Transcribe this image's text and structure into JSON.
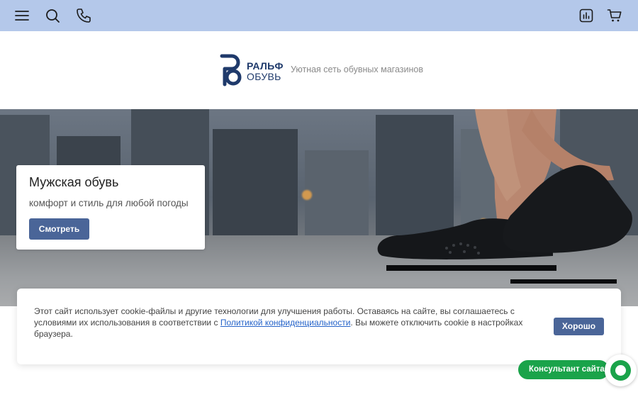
{
  "topbar": {
    "icons": [
      "menu-icon",
      "search-icon",
      "phone-icon",
      "compare-icon",
      "cart-icon"
    ],
    "bg_color": "#b4c8ea"
  },
  "header": {
    "logo_line1": "РАЛЬФ",
    "logo_line2": "ОБУВЬ",
    "tagline": "Уютная сеть обувных магазинов"
  },
  "hero": {
    "title": "Мужская обувь",
    "subtitle": "комфорт и стиль для любой погоды",
    "button": "Смотреть"
  },
  "cookie": {
    "text_before": "Этот сайт использует cookie-файлы и другие технологии для улучшения работы. Оставаясь на сайте, вы соглашаетесь с условиями их использования в соответствии с ",
    "link": "Политикой конфиденциальности",
    "text_after": ". Вы можете отключить cookie в настройках браузера.",
    "button": "Хорошо"
  },
  "chat": {
    "label": "Консультант сайта"
  },
  "colors": {
    "accent": "#4a6598",
    "chat_green": "#1aa34a",
    "link": "#2563c9"
  }
}
